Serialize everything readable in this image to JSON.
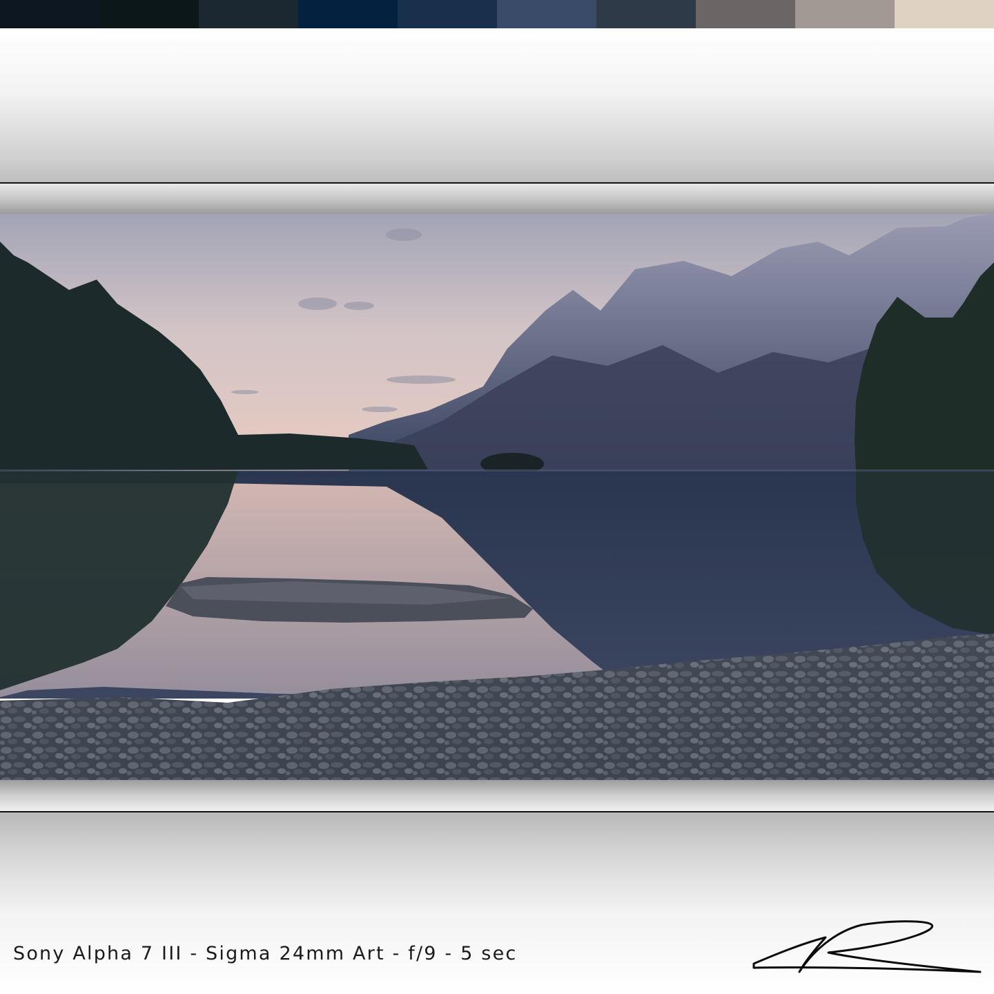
{
  "palette": {
    "swatches": [
      "#0c1722",
      "#0b1718",
      "#1b2832",
      "#04223f",
      "#18304c",
      "#3a4b6a",
      "#2e3a48",
      "#6b6566",
      "#a29894",
      "#e0d2c2"
    ]
  },
  "photo": {
    "subject": "mountain lake at dusk with reflection, rock and pebble shore",
    "colors": {
      "sky_top": "#a3a4b6",
      "sky_horizon": "#e9cbc1",
      "mountain": "#8a8ea6",
      "forest": "#1d2a2c",
      "water": "#2f3b55",
      "rock": "#4b4f5a",
      "pebbles": "#5a606c"
    }
  },
  "caption": {
    "text": "Sony Alpha 7 III - Sigma 24mm Art - f/9 - 5 sec"
  }
}
